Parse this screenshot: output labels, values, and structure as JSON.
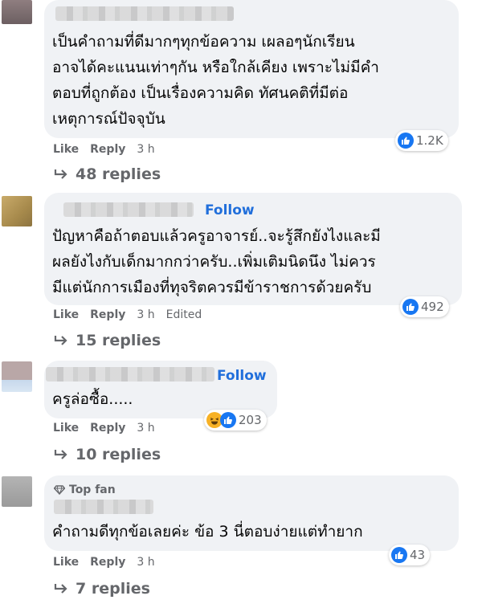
{
  "comments": [
    {
      "lines": [
        "เป็นคำถามที่ดีมากๆทุกข้อความ เผลอๆนักเรียน",
        "อาจได้คะแนนเท่าๆกัน หรือใกล้เคียง เพราะไม่มีคำ",
        "ตอบที่ถูกต้อง เป็นเรื่องความคิด ทัศนคติที่มีต่อ",
        "เหตุการณ์ปัจจุบัน"
      ],
      "reactions": "1.2K",
      "like": "Like",
      "reply": "Reply",
      "time": "3 h",
      "replies": "48 replies"
    },
    {
      "follow": "Follow",
      "lines": [
        "ปัญหาคือถ้าตอบแล้วครูอาจารย์..จะรู้สึกยังไงและมี",
        "ผลยังไงกับเด็กมากกว่าครับ..เพิ่มเติมนิดนึง ไม่ควร",
        "มีแต่นักการเมืองที่ทุจริตควรมีข้าราชการด้วยครับ"
      ],
      "reactions": "492",
      "like": "Like",
      "reply": "Reply",
      "time": "3 h",
      "edited": "Edited",
      "replies": "15 replies"
    },
    {
      "follow": "Follow",
      "lines": [
        "ครูล่อซื้อ....."
      ],
      "reactions": "203",
      "like": "Like",
      "reply": "Reply",
      "time": "3 h",
      "replies": "10 replies"
    },
    {
      "badge": "Top fan",
      "lines": [
        "คำถามดีทุกข้อเลยค่ะ ข้อ 3 นี่ตอบง่ายแต่ทำยาก"
      ],
      "reactions": "43",
      "like": "Like",
      "reply": "Reply",
      "time": "3 h",
      "replies": "7 replies"
    }
  ],
  "icons": {
    "like": "thumbs-up-icon",
    "haha": "laughing-face-icon",
    "reply_arrow": "reply-arrow-icon",
    "top_fan": "diamond-icon"
  },
  "colors": {
    "bubble": "#f0f2f5",
    "link_blue": "#216fdb",
    "like_blue": "#1877f2",
    "meta_gray": "#65676b"
  }
}
